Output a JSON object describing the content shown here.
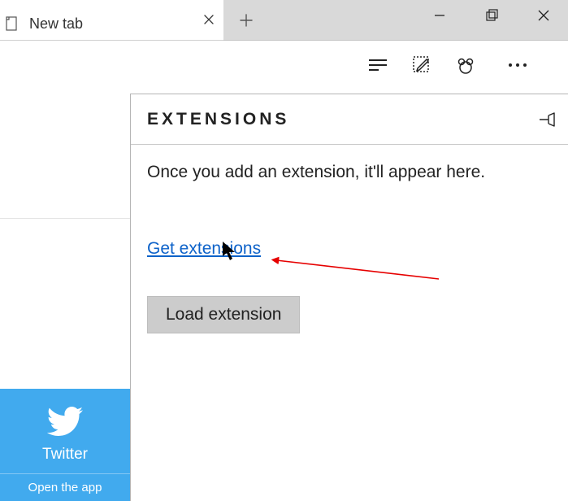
{
  "tab": {
    "title": "New tab"
  },
  "toolbar": {
    "hub_name": "hub",
    "notes_name": "webnote",
    "share_name": "share",
    "more_name": "more"
  },
  "flyout": {
    "title": "EXTENSIONS",
    "description": "Once you add an extension, it'll appear here.",
    "get_link": "Get extensions",
    "load_button": "Load extension"
  },
  "tile": {
    "label": "Twitter",
    "footer": "Open the app"
  }
}
